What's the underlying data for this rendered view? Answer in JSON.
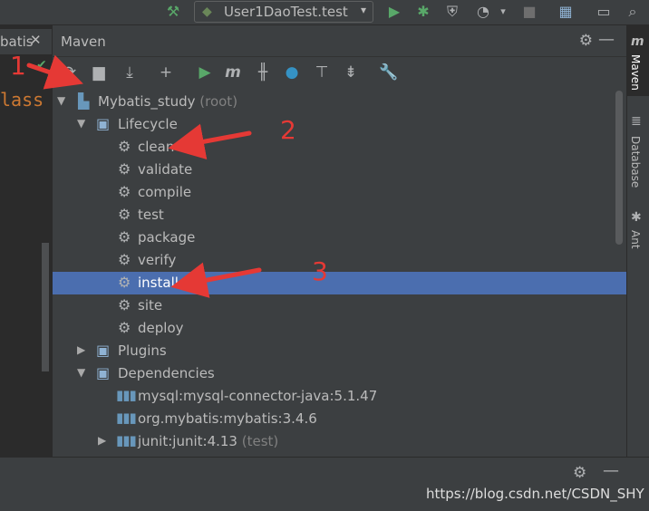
{
  "run_config": {
    "label": "User1DaoTest.test",
    "caret": "▾"
  },
  "editor": {
    "tab_text": "batis",
    "tab_close": "✕",
    "code_text": "lass"
  },
  "maven": {
    "title": "Maven",
    "toolbar": [
      "refresh-icon",
      "generate-sources-icon",
      "download-icon",
      "add-icon",
      "run-icon",
      "maven-goal-icon",
      "toggle-offline-icon",
      "skip-tests-icon",
      "show-dependencies-icon",
      "collapse-all-icon",
      "settings-wrench-icon"
    ],
    "tree": {
      "root": {
        "label": "Mybatis_study",
        "suffix": " (root)"
      },
      "lifecycle": {
        "label": "Lifecycle",
        "goals": [
          "clean",
          "validate",
          "compile",
          "test",
          "package",
          "verify",
          "install",
          "site",
          "deploy"
        ],
        "selected": "install"
      },
      "plugins": {
        "label": "Plugins"
      },
      "dependencies": {
        "label": "Dependencies",
        "items": [
          {
            "label": "mysql:mysql-connector-java:5.1.47",
            "suffix": ""
          },
          {
            "label": "org.mybatis:mybatis:3.4.6",
            "suffix": ""
          },
          {
            "label": "junit:junit:4.13",
            "suffix": " (test)"
          }
        ]
      }
    }
  },
  "right_strip": {
    "tabs": [
      "Maven",
      "Database",
      "Ant"
    ]
  },
  "annotations": {
    "n1": "1",
    "n2": "2",
    "n3": "3",
    "color": "#e53935"
  },
  "watermark": "https://blog.csdn.net/CSDN_SHY",
  "colors": {
    "selection": "#4b6eaf",
    "background": "#3c3f41",
    "editor_bg": "#2b2b2b"
  }
}
